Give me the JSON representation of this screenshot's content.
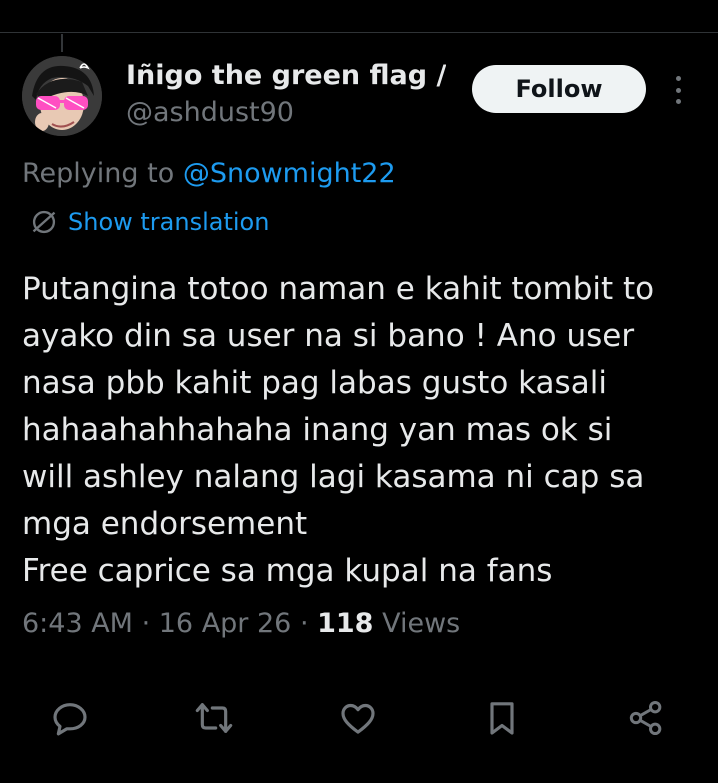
{
  "tweet": {
    "author_name": "Iñigo the green flag /...",
    "author_handle": "@ashdust90",
    "follow_label": "Follow",
    "replying_prefix": "Replying to",
    "replying_to": "@Snowmight22",
    "translate_label": "Show translation",
    "body": "Putangina totoo naman e kahit tombit to\nayako din sa user na si bano ! Ano user\nnasa pbb kahit pag labas gusto kasali\nhahaahahhahaha inang yan mas ok si\nwill ashley nalang lagi kasama ni cap sa\nmga endorsement\nFree caprice sa mga kupal na fans",
    "time": "6:43 AM",
    "date": "16 Apr 26",
    "views_count": "118",
    "views_label": "Views"
  },
  "icons": {
    "reply": "reply-icon",
    "retweet": "retweet-icon",
    "like": "heart-icon",
    "bookmark": "bookmark-icon",
    "share": "share-icon",
    "more": "more-icon",
    "translate": "translate-icon"
  },
  "colors": {
    "background": "#000000",
    "text": "#e7e9ea",
    "muted": "#71767b",
    "accent": "#1d9bf0"
  }
}
